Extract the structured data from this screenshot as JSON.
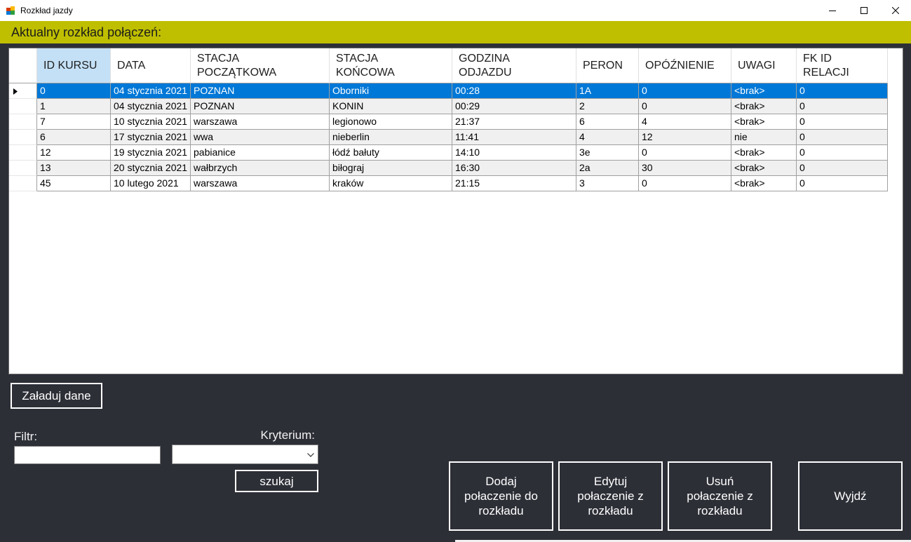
{
  "window": {
    "title": "Rozkład jazdy",
    "app_icon": "app-icon",
    "minimize_icon": "minimize-icon",
    "maximize_icon": "maximize-icon",
    "close_icon": "close-icon"
  },
  "colors": {
    "background": "#2d2f37",
    "banner": "#bfbf00",
    "selection": "#0078d7",
    "current_column_header": "#c4e0f6",
    "alternating_row": "#f0f0f0",
    "grid_line": "#a0a0a0",
    "button_border": "#ffffff"
  },
  "banner": {
    "text": "Aktualny rozkład połączeń:"
  },
  "grid": {
    "columns": [
      "ID KURSU",
      "DATA",
      "STACJA POCZĄTKOWA",
      "STACJA KOŃCOWA",
      "GODZINA ODJAZDU",
      "PERON",
      "OPÓŹNIENIE",
      "UWAGI",
      "FK ID RELACJI"
    ],
    "current_column": 0,
    "selected_row": 0,
    "current_row_icon": "row-pointer-icon",
    "rows": [
      [
        "0",
        "04 stycznia 2021",
        "POZNAN",
        "Oborniki",
        "00:28",
        "1A",
        "0",
        "<brak>",
        "0"
      ],
      [
        "1",
        "04 stycznia 2021",
        "POZNAN",
        "KONIN",
        "00:29",
        "2",
        "0",
        "<brak>",
        "0"
      ],
      [
        "7",
        "10 stycznia 2021",
        "warszawa",
        "legionowo",
        "21:37",
        "6",
        "4",
        "<brak>",
        "0"
      ],
      [
        "6",
        "17 stycznia 2021",
        "wwa",
        "nieberlin",
        "11:41",
        "4",
        "12",
        "nie",
        "0"
      ],
      [
        "12",
        "19 stycznia 2021",
        "pabianice",
        "łódź bałuty",
        "14:10",
        "3e",
        "0",
        "<brak>",
        "0"
      ],
      [
        "13",
        "20 stycznia 2021",
        "wałbrzych",
        "biłograj",
        "16:30",
        "2a",
        "30",
        "<brak>",
        "0"
      ],
      [
        "45",
        "10 lutego 2021",
        "warszawa",
        "kraków",
        "21:15",
        "3",
        "0",
        "<brak>",
        "0"
      ]
    ]
  },
  "controls": {
    "load_button": "Załaduj dane",
    "filter_label": "Filtr:",
    "filter_value": "",
    "criterion_label": "Kryterium:",
    "criterion_value": "",
    "criterion_dropdown_icon": "chevron-down-icon",
    "search_button": "szukaj"
  },
  "actions": {
    "add": "Dodaj połaczenie do rozkładu",
    "edit": "Edytuj połaczenie z rozkładu",
    "delete": "Usuń połaczenie z rozkładu",
    "exit": "Wyjdź"
  }
}
